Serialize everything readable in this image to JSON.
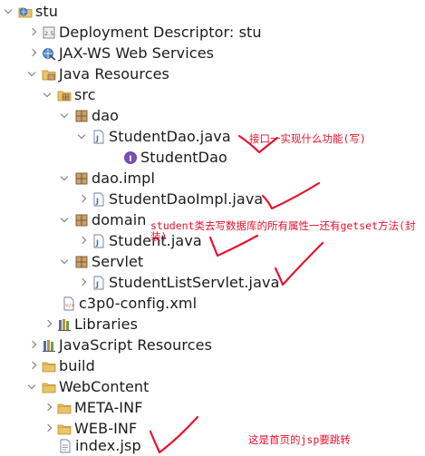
{
  "tree": {
    "project": "stu",
    "deployment_descriptor": "Deployment Descriptor: stu",
    "jaxws": "JAX-WS Web Services",
    "java_resources": "Java Resources",
    "src": "src",
    "pkg_dao": "dao",
    "file_studentdao": "StudentDao.java",
    "interface_studentdao": "StudentDao",
    "pkg_dao_impl": "dao.impl",
    "file_studentdaoimpl": "StudentDaoImpl.java",
    "pkg_domain": "domain",
    "file_student": "Student.java",
    "pkg_servlet": "Servlet",
    "file_servlet": "StudentListServlet.java",
    "file_c3p0": "c3p0-config.xml",
    "libraries": "Libraries",
    "js_resources": "JavaScript Resources",
    "build": "build",
    "webcontent": "WebContent",
    "meta_inf": "META-INF",
    "web_inf": "WEB-INF",
    "index": "index.jsp"
  },
  "annotations": {
    "dao_note": "接口一实现什么功能(写)",
    "student_note_line1": "student类去写数据库的所有属性一还有getset方法(封",
    "student_note_line2": "装)",
    "index_note": "这是首页的jsp要跳转"
  },
  "colors": {
    "annotation": "#e8112d",
    "folder": "#e9c46a",
    "package": "#a0794c",
    "java_file": "#3c6fb4",
    "interface": "#7a52b3"
  },
  "icons": {
    "project": "web-project-icon",
    "deployment_descriptor": "deployment-descriptor-icon",
    "jaxws": "web-services-icon",
    "java_resources": "java-resources-icon",
    "src": "source-folder-icon",
    "package": "package-icon",
    "java_file": "java-file-icon",
    "interface": "interface-icon",
    "xml": "xml-file-icon",
    "libraries": "libraries-icon",
    "js_resources": "javascript-resources-icon",
    "folder": "folder-icon",
    "jsp": "jsp-file-icon"
  }
}
